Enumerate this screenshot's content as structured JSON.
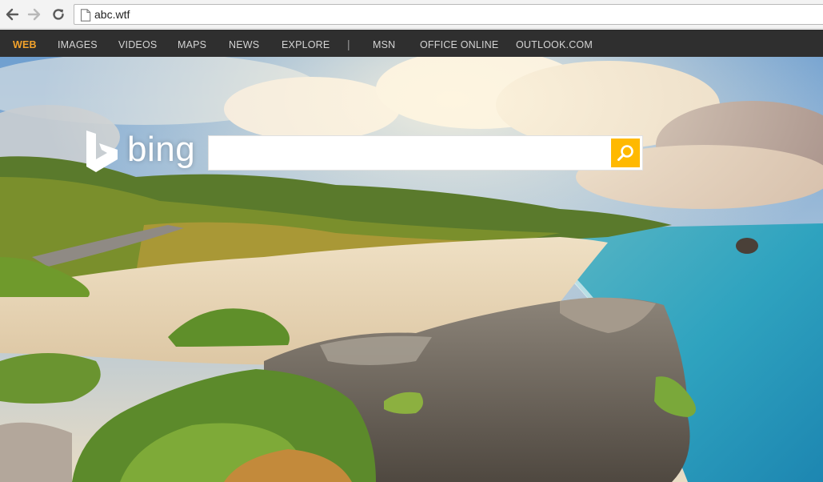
{
  "browser": {
    "url": "abc.wtf",
    "icons": {
      "back": "back-arrow-icon",
      "forward": "forward-arrow-icon",
      "reload": "reload-icon",
      "page": "page-icon"
    }
  },
  "nav": {
    "items": [
      {
        "label": "WEB",
        "active": true
      },
      {
        "label": "IMAGES",
        "active": false
      },
      {
        "label": "VIDEOS",
        "active": false
      },
      {
        "label": "MAPS",
        "active": false
      },
      {
        "label": "NEWS",
        "active": false
      },
      {
        "label": "EXPLORE",
        "active": false
      },
      {
        "label": "MSN",
        "active": false
      },
      {
        "label": "OFFICE ONLINE",
        "active": false
      },
      {
        "label": "OUTLOOK.COM",
        "active": false
      }
    ],
    "separator": "|"
  },
  "logo": {
    "text": "bing"
  },
  "search": {
    "value": "",
    "icon": "search-icon"
  },
  "colors": {
    "nav_bg": "#2f2f2f",
    "nav_active": "#f2a22b",
    "nav_text": "#d4d4d4",
    "search_button": "#ffb900"
  }
}
